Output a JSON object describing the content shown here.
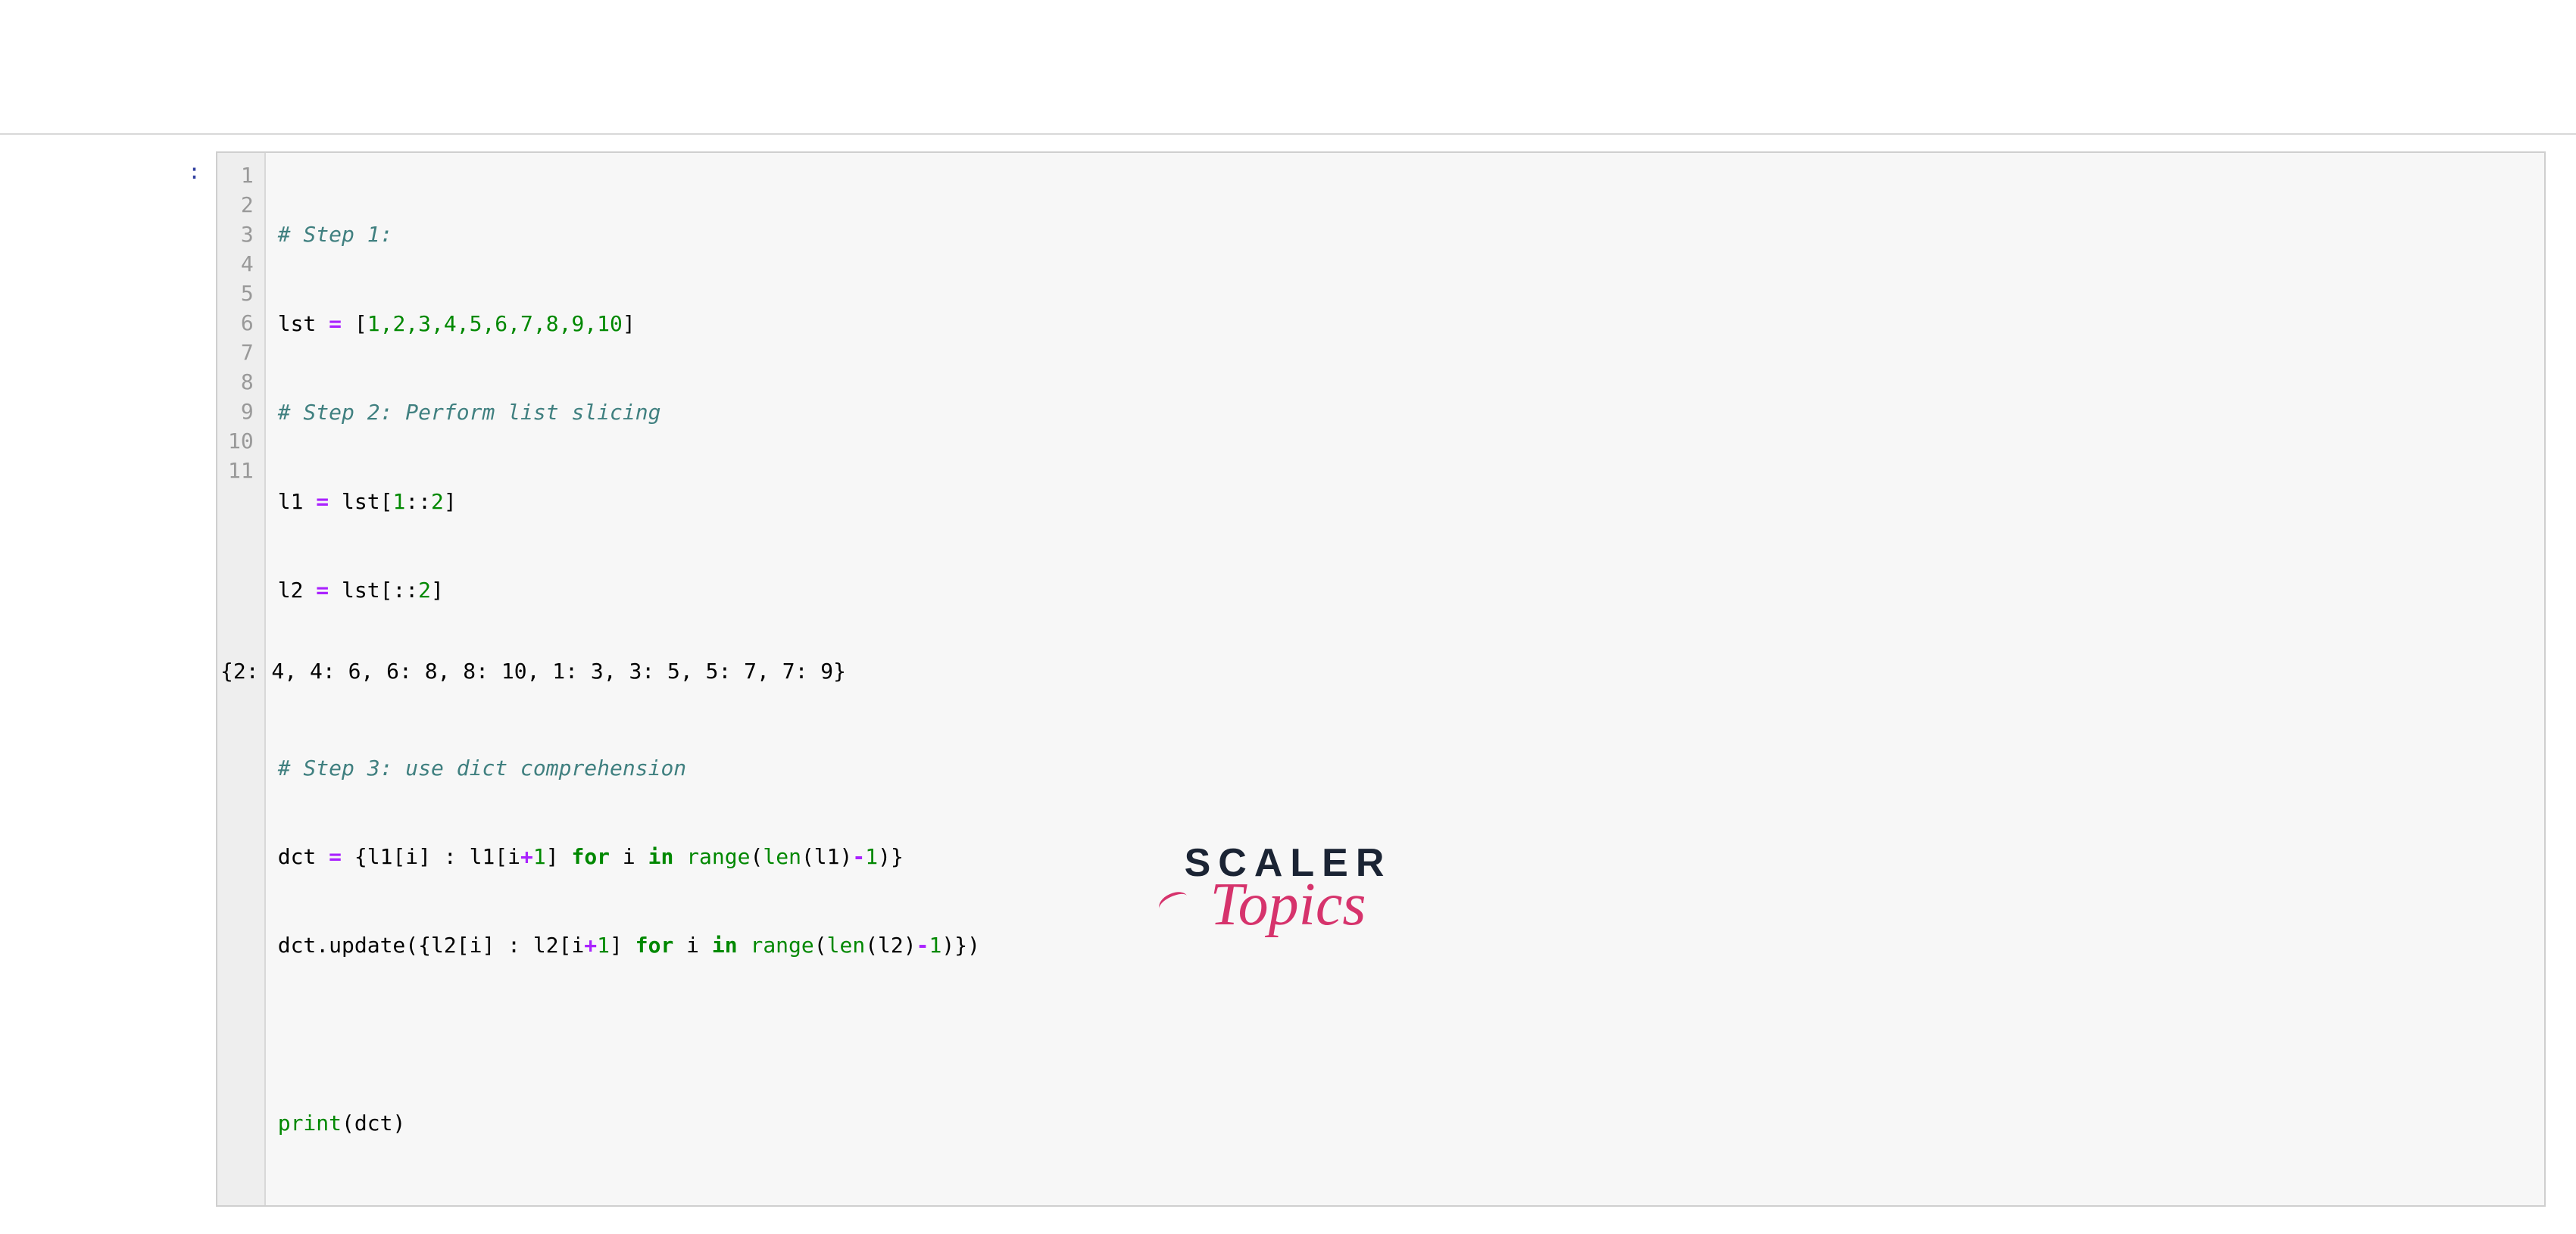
{
  "prompt": ":",
  "gutter": [
    "1",
    "2",
    "3",
    "4",
    "5",
    "6",
    "7",
    "8",
    "9",
    "10",
    "11"
  ],
  "code": {
    "l1_comment": "# Step 1:",
    "l2_a": "lst ",
    "l2_op": "=",
    "l2_b": " [",
    "l2_nums": "1,2,3,4,5,6,7,8,9,10",
    "l2_c": "]",
    "l3_comment": "# Step 2: Perform list slicing",
    "l4_a": "l1 ",
    "l4_op": "=",
    "l4_b": " lst[",
    "l4_n1": "1",
    "l4_c": "::",
    "l4_n2": "2",
    "l4_d": "]",
    "l5_a": "l2 ",
    "l5_op": "=",
    "l5_b": " lst[::",
    "l5_n": "2",
    "l5_c": "]",
    "l7_comment": "# Step 3: use dict comprehension",
    "l8_a": "dct ",
    "l8_op1": "=",
    "l8_b": " {l1[i] : l1[i",
    "l8_plus": "+",
    "l8_n1": "1",
    "l8_c": "] ",
    "l8_for": "for",
    "l8_d": " i ",
    "l8_in": "in",
    "l8_e": " ",
    "l8_range": "range",
    "l8_f": "(",
    "l8_len": "len",
    "l8_g": "(l1)",
    "l8_minus": "-",
    "l8_n2": "1",
    "l8_h": ")}",
    "l9_a": "dct.update({l2[i] : l2[i",
    "l9_plus": "+",
    "l9_n1": "1",
    "l9_b": "] ",
    "l9_for": "for",
    "l9_c": " i ",
    "l9_in": "in",
    "l9_d": " ",
    "l9_range": "range",
    "l9_e": "(",
    "l9_len": "len",
    "l9_f": "(l2)",
    "l9_minus": "-",
    "l9_n2": "1",
    "l9_g": ")})",
    "l11_print": "print",
    "l11_a": "(dct)"
  },
  "output": "{2: 4, 4: 6, 6: 8, 8: 10, 1: 3, 3: 5, 5: 7, 7: 9}",
  "logo": {
    "scaler": "SCALER",
    "topics": "Topics"
  }
}
